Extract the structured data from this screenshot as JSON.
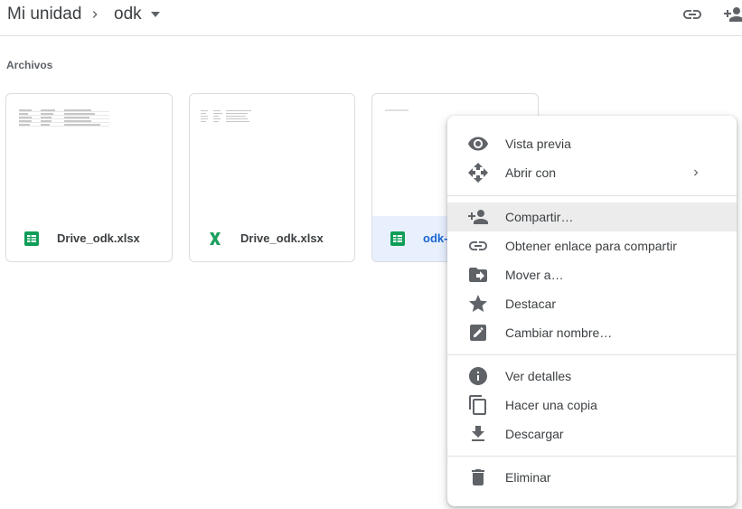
{
  "header": {
    "breadcrumb_root": "Mi unidad",
    "breadcrumb_current": "odk"
  },
  "section": {
    "label": "Archivos"
  },
  "files": [
    {
      "name": "Drive_odk.xlsx",
      "icon": "google-sheets-icon"
    },
    {
      "name": "Drive_odk.xlsx",
      "icon": "excel-icon"
    },
    {
      "name": "odk-",
      "icon": "google-sheets-icon"
    }
  ],
  "menu": {
    "items": [
      {
        "label": "Vista previa",
        "icon": "eye-icon"
      },
      {
        "label": "Abrir con",
        "icon": "move-arrows-icon"
      },
      {
        "label": "Compartir…",
        "icon": "person-add-icon"
      },
      {
        "label": "Obtener enlace para compartir",
        "icon": "link-icon"
      },
      {
        "label": "Mover a…",
        "icon": "folder-move-icon"
      },
      {
        "label": "Destacar",
        "icon": "star-icon"
      },
      {
        "label": "Cambiar nombre…",
        "icon": "edit-icon"
      },
      {
        "label": "Ver detalles",
        "icon": "info-icon"
      },
      {
        "label": "Hacer una copia",
        "icon": "copy-icon"
      },
      {
        "label": "Descargar",
        "icon": "download-icon"
      },
      {
        "label": "Eliminar",
        "icon": "trash-icon"
      }
    ]
  },
  "colors": {
    "sheets_green": "#0f9d58",
    "excel_green": "#1d9f5f",
    "selected_bg": "#e8f0fe",
    "selected_text": "#1967d2",
    "icon_gray": "#5f6368"
  }
}
